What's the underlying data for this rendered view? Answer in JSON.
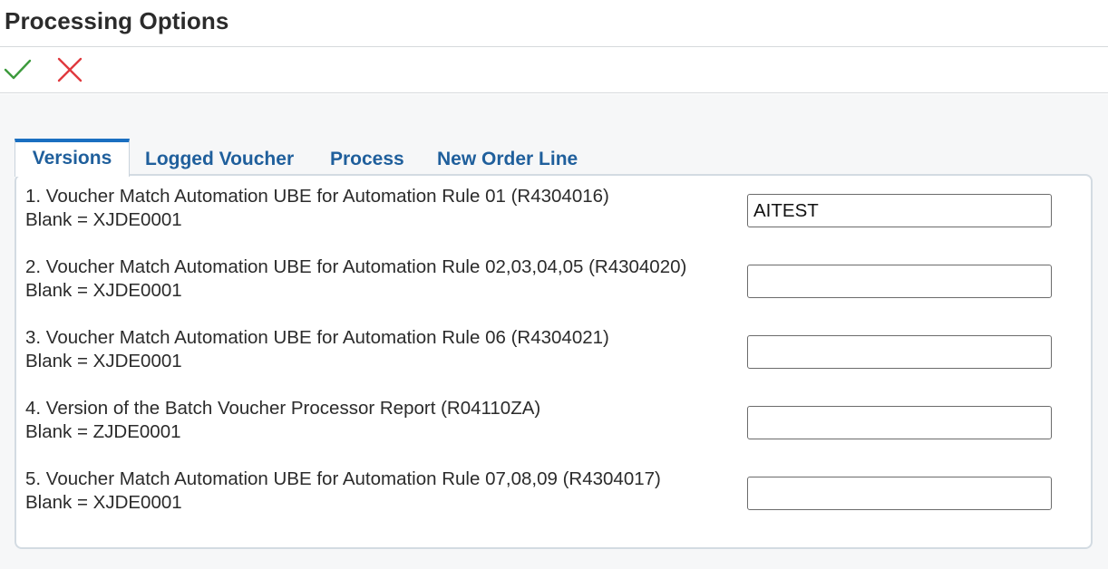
{
  "header": {
    "title": "Processing Options"
  },
  "toolbar": {
    "ok_icon": "checkmark-icon",
    "cancel_icon": "close-icon",
    "ok_color": "#3c9a3c",
    "cancel_color": "#e0393e"
  },
  "tabs": [
    {
      "label": "Versions",
      "active": true
    },
    {
      "label": "Logged Voucher"
    },
    {
      "label": "Process"
    },
    {
      "label": "New Order Line"
    }
  ],
  "options": [
    {
      "line1": "1. Voucher Match Automation UBE for Automation Rule 01 (R4304016)",
      "line2": "Blank = XJDE0001",
      "value": "AITEST"
    },
    {
      "line1": "2. Voucher Match Automation UBE for Automation Rule 02,03,04,05 (R4304020)",
      "line2": "Blank = XJDE0001",
      "value": ""
    },
    {
      "line1": "3. Voucher Match Automation UBE for Automation Rule 06 (R4304021)",
      "line2": "Blank = XJDE0001",
      "value": ""
    },
    {
      "line1": "4. Version of the Batch Voucher Processor Report (R04110ZA)",
      "line2": "Blank = ZJDE0001",
      "value": ""
    },
    {
      "line1": "5. Voucher Match Automation UBE for Automation Rule 07,08,09 (R4304017)",
      "line2": "Blank = XJDE0001",
      "value": ""
    }
  ]
}
